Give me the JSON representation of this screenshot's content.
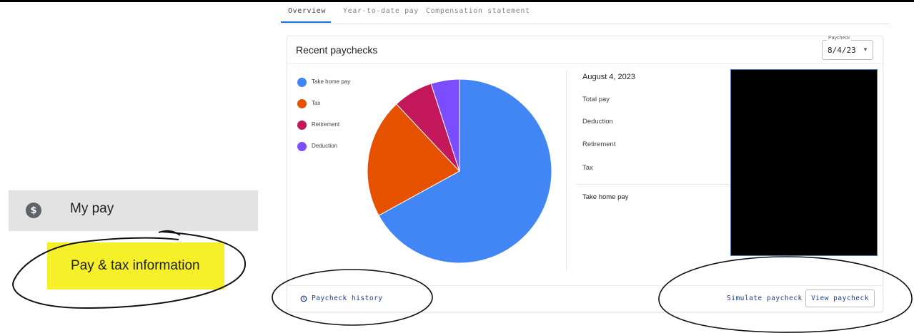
{
  "sidebar": {
    "my_pay": {
      "icon": "dollar-coin-icon",
      "icon_glyph": "$",
      "label": "My pay"
    },
    "pay_tax": {
      "label": "Pay & tax information",
      "highlight_color": "#f6f02a"
    }
  },
  "tabs": [
    {
      "label": "Overview",
      "active": true
    },
    {
      "label": "Year-to-date pay",
      "active": false
    },
    {
      "label": "Compensation statement",
      "active": false
    }
  ],
  "card": {
    "title": "Recent paychecks",
    "paycheck_select": {
      "label": "Paycheck",
      "value": "8/4/23",
      "icon": "caret-down-icon"
    }
  },
  "chart_data": {
    "type": "pie",
    "slices": [
      {
        "label": "Take home pay",
        "value": 0.67,
        "color": "#4285f4"
      },
      {
        "label": "Tax",
        "value": 0.21,
        "color": "#e65100"
      },
      {
        "label": "Retirement",
        "value": 0.07,
        "color": "#c2185b"
      },
      {
        "label": "Deduction",
        "value": 0.05,
        "color": "#7c4dff"
      }
    ]
  },
  "details": {
    "date": "August 4, 2023",
    "rows": [
      "Total pay",
      "Deduction",
      "Retirement",
      "Tax"
    ],
    "take_home_label": "Take home pay"
  },
  "footer": {
    "history": "Paycheck history",
    "history_icon": "history-icon",
    "simulate": "Simulate paycheck",
    "view": "View paycheck"
  }
}
